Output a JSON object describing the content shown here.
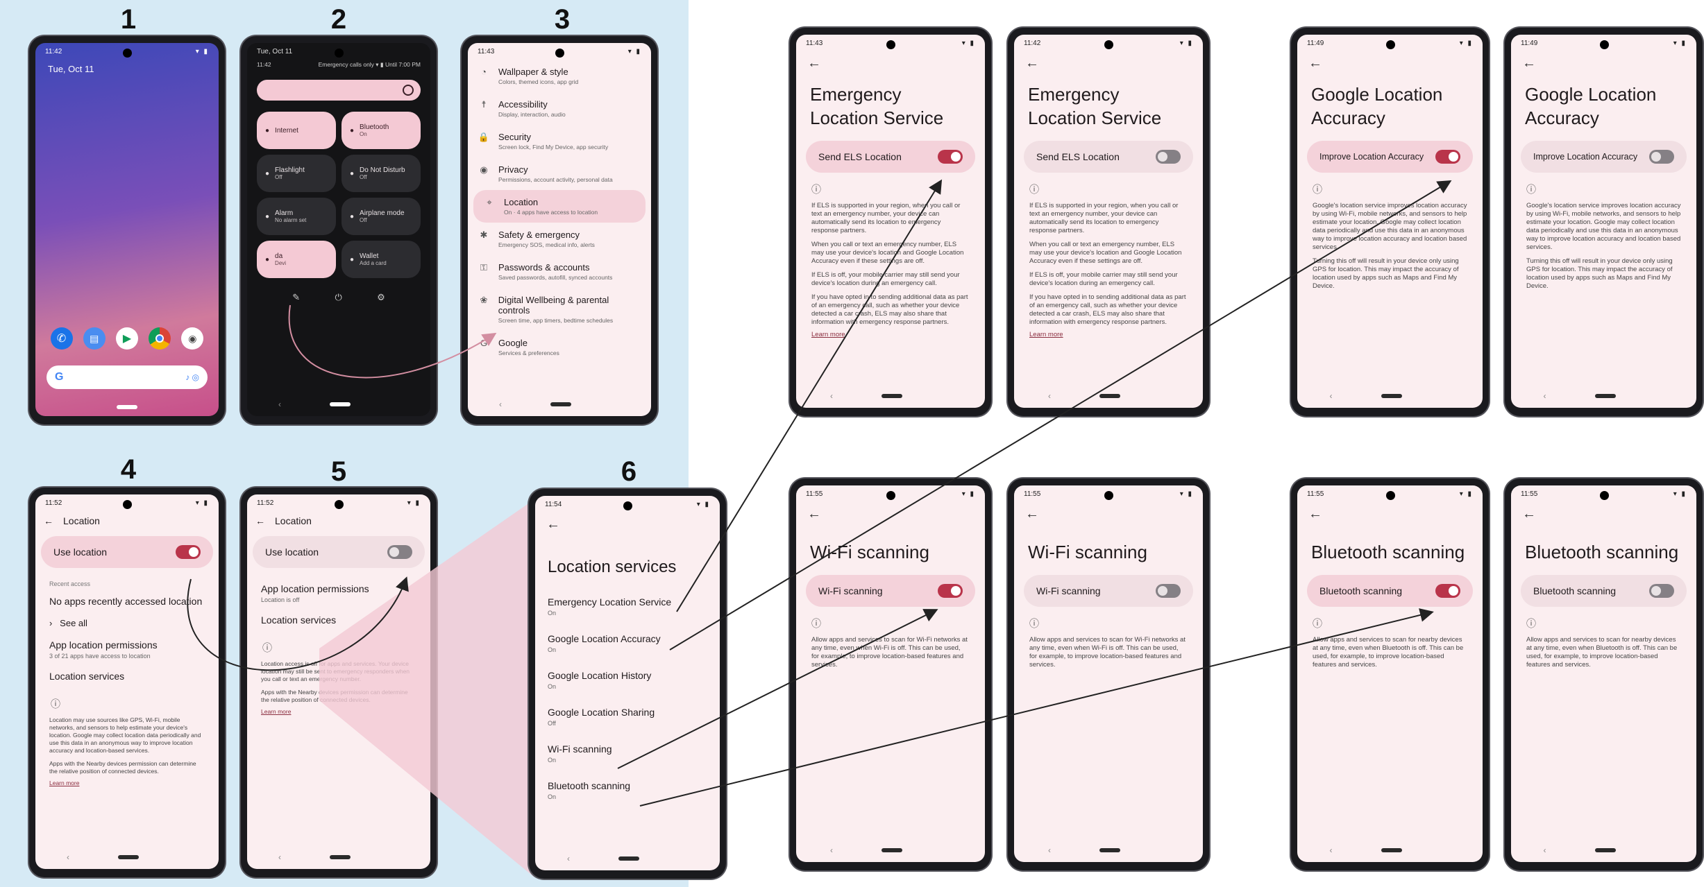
{
  "steps": [
    "1",
    "2",
    "3",
    "4",
    "5",
    "6"
  ],
  "phone1": {
    "status_time": "11:42",
    "date": "Tue, Oct 11",
    "search_g": "G"
  },
  "phone2": {
    "date": "Tue, Oct 11",
    "time": "11:42",
    "status_right": "Emergency calls only",
    "battery": "Until 7:00 PM",
    "tiles": [
      {
        "label": "Internet",
        "sub": "",
        "on": true
      },
      {
        "label": "Bluetooth",
        "sub": "On",
        "on": true
      },
      {
        "label": "Flashlight",
        "sub": "Off",
        "on": false
      },
      {
        "label": "Do Not Disturb",
        "sub": "Off",
        "on": false
      },
      {
        "label": "Alarm",
        "sub": "No alarm set",
        "on": false
      },
      {
        "label": "Airplane mode",
        "sub": "Off",
        "on": false
      },
      {
        "label": "da",
        "sub": "Devi",
        "on": true
      },
      {
        "label": "Wallet",
        "sub": "Add a card",
        "on": false
      }
    ]
  },
  "phone3": {
    "status_time": "11:43",
    "items": [
      {
        "icon": "palette-icon",
        "title": "Wallpaper & style",
        "sub": "Colors, themed icons, app grid"
      },
      {
        "icon": "accessibility-icon",
        "title": "Accessibility",
        "sub": "Display, interaction, audio"
      },
      {
        "icon": "lock-icon",
        "title": "Security",
        "sub": "Screen lock, Find My Device, app security"
      },
      {
        "icon": "eye-icon",
        "title": "Privacy",
        "sub": "Permissions, account activity, personal data"
      },
      {
        "icon": "location-pin-icon",
        "title": "Location",
        "sub": "On · 4 apps have access to location"
      },
      {
        "icon": "asterisk-icon",
        "title": "Safety & emergency",
        "sub": "Emergency SOS, medical info, alerts"
      },
      {
        "icon": "key-icon",
        "title": "Passwords & accounts",
        "sub": "Saved passwords, autofill, synced accounts"
      },
      {
        "icon": "wellbeing-icon",
        "title": "Digital Wellbeing & parental controls",
        "sub": "Screen time, app timers, bedtime schedules"
      },
      {
        "icon": "google-icon",
        "title": "Google",
        "sub": "Services & preferences"
      }
    ]
  },
  "phone4": {
    "status_time": "11:52",
    "header": "Location",
    "toggle_label": "Use location",
    "recent_header": "Recent access",
    "no_apps": "No apps recently accessed location",
    "see_all": "See all",
    "app_perm_title": "App location permissions",
    "app_perm_sub": "3 of 21 apps have access to location",
    "loc_services": "Location services",
    "body1": "Location may use sources like GPS, Wi-Fi, mobile networks, and sensors to help estimate your device's location. Google may collect location data periodically and use this data in an anonymous way to improve location accuracy and location-based services.",
    "body2": "Apps with the Nearby devices permission can determine the relative position of connected devices.",
    "learn": "Learn more"
  },
  "phone5": {
    "status_time": "11:52",
    "header": "Location",
    "toggle_label": "Use location",
    "app_perm_title": "App location permissions",
    "app_perm_sub": "Location is off",
    "loc_services": "Location services",
    "body1": "Location access is off for apps and services. Your device location may still be sent to emergency responders when you call or text an emergency number.",
    "body2": "Apps with the Nearby devices permission can determine the relative position of connected devices.",
    "learn": "Learn more"
  },
  "phone6": {
    "status_time": "11:54",
    "title": "Location services",
    "items": [
      {
        "t": "Emergency Location Service",
        "s": "On"
      },
      {
        "t": "Google Location Accuracy",
        "s": "On"
      },
      {
        "t": "Google Location History",
        "s": "On"
      },
      {
        "t": "Google Location Sharing",
        "s": "Off"
      },
      {
        "t": "Wi-Fi scanning",
        "s": "On"
      },
      {
        "t": "Bluetooth scanning",
        "s": "On"
      }
    ]
  },
  "els": {
    "title": "Emergency Location Service",
    "toggle": "Send ELS Location",
    "p1": "If ELS is supported in your region, when you call or text an emergency number, your device can automatically send its location to emergency response partners.",
    "p2": "When you call or text an emergency number, ELS may use your device's location and Google Location Accuracy even if these settings are off.",
    "p3": "If ELS is off, your mobile carrier may still send your device's location during an emergency call.",
    "p4": "If you have opted in to sending additional data as part of an emergency call, such as whether your device detected a car crash, ELS may also share that information with emergency response partners.",
    "learn": "Learn more",
    "time_on": "11:43",
    "time_off": "11:42"
  },
  "gla": {
    "title": "Google Location Accuracy",
    "toggle": "Improve Location Accuracy",
    "p1": "Google's location service improves location accuracy by using Wi-Fi, mobile networks, and sensors to help estimate your location. Google may collect location data periodically and use this data in an anonymous way to improve location accuracy and location based services.",
    "p2": "Turning this off will result in your device only using GPS for location. This may impact the accuracy of location used by apps such as Maps and Find My Device.",
    "time": "11:49"
  },
  "wifi": {
    "title": "Wi-Fi scanning",
    "toggle": "Wi-Fi scanning",
    "p1": "Allow apps and services to scan for Wi-Fi networks at any time, even when Wi-Fi is off. This can be used, for example, to improve location-based features and services.",
    "time": "11:55"
  },
  "bt": {
    "title": "Bluetooth scanning",
    "toggle": "Bluetooth scanning",
    "p1": "Allow apps and services to scan for nearby devices at any time, even when Bluetooth is off. This can be used, for example, to improve location-based features and services.",
    "time": "11:55"
  },
  "colors": {
    "accent": "#b9344a",
    "panel_bg": "#fbeef0",
    "highlight": "#f4d2da",
    "blue_bg": "#d6eaf5"
  }
}
